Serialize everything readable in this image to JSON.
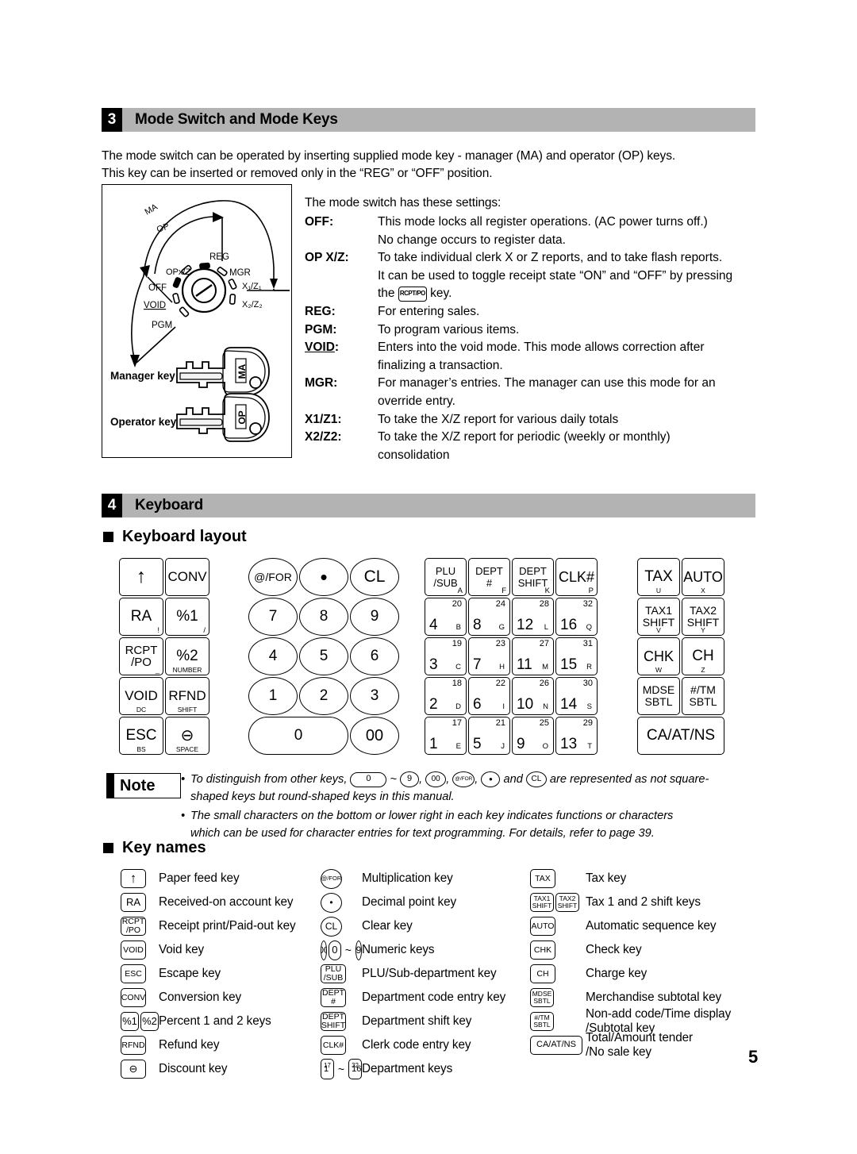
{
  "page": {
    "number": "5"
  },
  "section3": {
    "number": "3",
    "title": "Mode Switch and Mode Keys",
    "intro_line1": "The mode switch can be operated by inserting supplied mode key - manager (MA) and operator (OP) keys.",
    "intro_line2": "This key can be inserted or removed only in the “REG” or “OFF” position.",
    "settings_lead": "The mode switch has these settings:",
    "figure": {
      "dial_labels": [
        "MA",
        "OP",
        "REG",
        "OPx/Z",
        "MGR",
        "OFF",
        "X₁/Z₁",
        "VOID",
        "X₂/Z₂",
        "PGM"
      ],
      "manager_key_caption": "Manager key (MA)",
      "operator_key_caption": "Operator key (OP)",
      "manager_key_tag": "MA",
      "operator_key_tag": "OP"
    },
    "modes": [
      {
        "label": "OFF:",
        "underline": false,
        "lines": [
          "This mode locks all register operations. (AC power turns off.)",
          "No change occurs to register data."
        ]
      },
      {
        "label": "OP X/Z:",
        "underline": false,
        "lines": [
          "To take individual clerk X or Z reports, and to take flash reports.",
          "It can be used to toggle receipt state “ON” and “OFF” by pressing",
          "the [RCPT/PO] key."
        ],
        "inline_key": "RCPT/PO"
      },
      {
        "label": "REG:",
        "underline": false,
        "lines": [
          "For entering sales."
        ]
      },
      {
        "label": "PGM:",
        "underline": false,
        "lines": [
          "To program various items."
        ]
      },
      {
        "label": "VOID:",
        "underline": true,
        "lines": [
          "Enters into the void mode.  This mode allows correction after",
          "finalizing a transaction."
        ]
      },
      {
        "label": "MGR:",
        "underline": false,
        "lines": [
          "For manager’s entries.  The manager can use this mode for an",
          "override entry."
        ]
      },
      {
        "label": "X1/Z1:",
        "underline": false,
        "lines": [
          "To take the X/Z report for various daily totals"
        ]
      },
      {
        "label": "X2/Z2:",
        "underline": false,
        "lines": [
          "To take the X/Z report for periodic (weekly or monthly)",
          "consolidation"
        ]
      }
    ]
  },
  "section4": {
    "number": "4",
    "title": "Keyboard",
    "sub_layout": "Keyboard layout",
    "sub_keynames": "Key names"
  },
  "keyboard": {
    "block_left": [
      [
        {
          "main": "↑",
          "sub": ""
        },
        {
          "main": "CONV",
          "sub": ""
        }
      ],
      [
        {
          "main": "RA",
          "sub": "!"
        },
        {
          "main": "%1",
          "sub": "/"
        }
      ],
      [
        {
          "line1": "RCPT",
          "line2": "/PO",
          "sub": "_"
        },
        {
          "main": "%2",
          "subc": "NUMBER"
        }
      ],
      [
        {
          "main": "VOID",
          "subc": "DC"
        },
        {
          "main": "RFND",
          "subc": "SHIFT"
        }
      ],
      [
        {
          "main": "ESC",
          "subc": "BS"
        },
        {
          "main": "⊖",
          "subc": "SPACE"
        }
      ]
    ],
    "block_numeric": [
      [
        "@/FOR",
        "•",
        "CL"
      ],
      [
        "7",
        "8",
        "9"
      ],
      [
        "4",
        "5",
        "6"
      ],
      [
        "1",
        "2",
        "3"
      ],
      [
        "0",
        "00"
      ]
    ],
    "block_dept": [
      [
        {
          "line1": "PLU",
          "line2": "/SUB",
          "sub": "A"
        },
        {
          "line1": "DEPT",
          "line2": "#",
          "sub": "F"
        },
        {
          "line1": "DEPT",
          "line2": "SHIFT",
          "sub": "K"
        },
        {
          "main": "CLK#",
          "sub": "P"
        }
      ],
      [
        {
          "num": "4",
          "top": "20",
          "sub": "B"
        },
        {
          "num": "8",
          "top": "24",
          "sub": "G"
        },
        {
          "num": "12",
          "top": "28",
          "sub": "L"
        },
        {
          "num": "16",
          "top": "32",
          "sub": "Q"
        }
      ],
      [
        {
          "num": "3",
          "top": "19",
          "sub": "C"
        },
        {
          "num": "7",
          "top": "23",
          "sub": "H"
        },
        {
          "num": "11",
          "top": "27",
          "sub": "M"
        },
        {
          "num": "15",
          "top": "31",
          "sub": "R"
        }
      ],
      [
        {
          "num": "2",
          "top": "18",
          "sub": "D"
        },
        {
          "num": "6",
          "top": "22",
          "sub": "I"
        },
        {
          "num": "10",
          "top": "26",
          "sub": "N"
        },
        {
          "num": "14",
          "top": "30",
          "sub": "S"
        }
      ],
      [
        {
          "num": "1",
          "top": "17",
          "sub": "E"
        },
        {
          "num": "5",
          "top": "21",
          "sub": "J"
        },
        {
          "num": "9",
          "top": "25",
          "sub": "O"
        },
        {
          "num": "13",
          "top": "29",
          "sub": "T"
        }
      ]
    ],
    "block_right": [
      [
        {
          "main": "TAX",
          "subc": "U"
        },
        {
          "main": "AUTO",
          "subc": "X"
        }
      ],
      [
        {
          "line1": "TAX1",
          "line2": "SHIFT",
          "subc": "V"
        },
        {
          "line1": "TAX2",
          "line2": "SHIFT",
          "subc": "Y"
        }
      ],
      [
        {
          "main": "CHK",
          "subc": "W"
        },
        {
          "main": "CH",
          "subc": "Z"
        }
      ],
      [
        {
          "line1": "MDSE",
          "line2": "SBTL"
        },
        {
          "line1": "#/TM",
          "line2": "SBTL"
        }
      ],
      [
        {
          "main": "CA/AT/NS"
        }
      ]
    ]
  },
  "note": {
    "label": "Note",
    "item1_a": "To distinguish from other keys,",
    "item1_keys": [
      "0",
      "~",
      "9",
      "00",
      "@/FOR",
      "•",
      "and",
      "CL"
    ],
    "item1_b": "are represented as not square-",
    "item1_line2": "shaped keys but round-shaped keys in this manual.",
    "item2_line1": "The small characters on the bottom or lower right in each key indicates functions or characters",
    "item2_line2": "which can be used for character entries for text programming.  For details, refer to page 39."
  },
  "keynames": {
    "col1": [
      {
        "keys": [
          {
            "main": "↑",
            "size": "big"
          }
        ],
        "label": "Paper feed key"
      },
      {
        "keys": [
          {
            "main": "RA"
          }
        ],
        "label": "Received-on account key"
      },
      {
        "keys": [
          {
            "line1": "RCPT",
            "line2": "/PO",
            "small": true
          }
        ],
        "label": "Receipt print/Paid-out key"
      },
      {
        "keys": [
          {
            "main": "VOID",
            "small": true
          }
        ],
        "label": "Void key"
      },
      {
        "keys": [
          {
            "main": "ESC",
            "small": true
          }
        ],
        "label": "Escape key"
      },
      {
        "keys": [
          {
            "main": "CONV",
            "small": true
          }
        ],
        "label": "Conversion key"
      },
      {
        "keys": [
          {
            "main": "%1"
          },
          {
            "main": "%2"
          }
        ],
        "label": "Percent 1 and 2 keys"
      },
      {
        "keys": [
          {
            "main": "RFND",
            "small": true
          }
        ],
        "label": "Refund key"
      },
      {
        "keys": [
          {
            "main": "⊖"
          }
        ],
        "label": "Discount key"
      }
    ],
    "col2": [
      {
        "keys": [
          {
            "main": "@/FOR",
            "shape": "round",
            "small": true
          }
        ],
        "label": "Multiplication key"
      },
      {
        "keys": [
          {
            "main": "•",
            "shape": "round"
          }
        ],
        "label": "Decimal point key"
      },
      {
        "keys": [
          {
            "main": "CL",
            "shape": "round"
          }
        ],
        "label": "Clear key"
      },
      {
        "keys": [
          {
            "main": "00",
            "shape": "round"
          },
          {
            "main": "0",
            "shape": "pill"
          },
          {
            "main": "~",
            "shape": "none"
          },
          {
            "main": "9",
            "shape": "round"
          }
        ],
        "label": "Numeric keys"
      },
      {
        "keys": [
          {
            "line1": "PLU",
            "line2": "/SUB",
            "small": true
          }
        ],
        "label": "PLU/Sub-department key"
      },
      {
        "keys": [
          {
            "line1": "DEPT",
            "line2": "#",
            "small": true
          }
        ],
        "label": "Department code entry key"
      },
      {
        "keys": [
          {
            "line1": "DEPT",
            "line2": "SHIFT",
            "small": true
          }
        ],
        "label": "Department shift key"
      },
      {
        "keys": [
          {
            "main": "CLK#",
            "small": true
          }
        ],
        "label": "Clerk code entry key"
      },
      {
        "keys": [
          {
            "num": "1",
            "top": "17"
          },
          {
            "main": "~",
            "shape": "none"
          },
          {
            "num": "16",
            "top": "32"
          }
        ],
        "label": "Department keys"
      }
    ],
    "col3": [
      {
        "keys": [
          {
            "main": "TAX",
            "small": true
          }
        ],
        "label": "Tax key"
      },
      {
        "keys": [
          {
            "line1": "TAX1",
            "line2": "SHIFT",
            "tiny": true
          },
          {
            "line1": "TAX2",
            "line2": "SHIFT",
            "tiny": true
          }
        ],
        "label": "Tax 1 and 2 shift keys"
      },
      {
        "keys": [
          {
            "main": "AUTO",
            "small": true
          }
        ],
        "label": "Automatic sequence key"
      },
      {
        "keys": [
          {
            "main": "CHK",
            "small": true
          }
        ],
        "label": "Check key"
      },
      {
        "keys": [
          {
            "main": "CH",
            "small": true
          }
        ],
        "label": "Charge key"
      },
      {
        "keys": [
          {
            "line1": "MDSE",
            "line2": "SBTL",
            "tiny": true
          }
        ],
        "label": "Merchandise subtotal key"
      },
      {
        "keys": [
          {
            "line1": "#/TM",
            "line2": "SBTL",
            "tiny": true
          }
        ],
        "label": "Non-add code/Time display\n/Subtotal key"
      },
      {
        "keys": [
          {
            "main": "CA/AT/NS",
            "wide": true,
            "tiny": true
          }
        ],
        "label": "Total/Amount tender\n/No sale key"
      }
    ]
  }
}
